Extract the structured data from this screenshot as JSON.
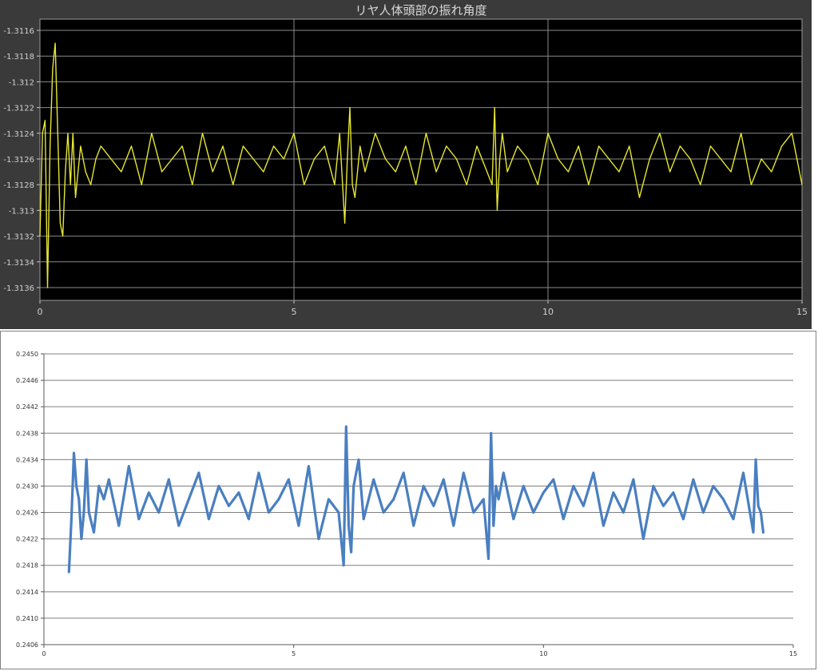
{
  "chart_data": [
    {
      "type": "line",
      "title": "リヤ人体頭部の振れ角度",
      "xlabel": "",
      "ylabel": "",
      "xlim": [
        0,
        15
      ],
      "ylim": [
        -1.3137,
        -1.3115
      ],
      "xticks": [
        0,
        5,
        10,
        15
      ],
      "xtick_labels": [
        "0",
        "5",
        "10",
        "15"
      ],
      "yticks": [
        -1.3116,
        -1.3118,
        -1.312,
        -1.3122,
        -1.3124,
        -1.3126,
        -1.3128,
        -1.313,
        -1.3132,
        -1.3134,
        -1.3136
      ],
      "ytick_labels": [
        "-1.3116",
        "-1.3118",
        "-1.312",
        "-1.3122",
        "-1.3124",
        "-1.3126",
        "-1.3128",
        "-1.313",
        "-1.3132",
        "-1.3134",
        "-1.3136"
      ],
      "grid": true,
      "colors": {
        "background": "#000000",
        "line": "#e6e632",
        "grid": "#8a8a8a",
        "panel": "#3a3a3a"
      },
      "series": [
        {
          "x": [
            0,
            0.05,
            0.1,
            0.15,
            0.2,
            0.25,
            0.3,
            0.35,
            0.4,
            0.45,
            0.5,
            0.55,
            0.6,
            0.65,
            0.7,
            0.8,
            0.9,
            1.0,
            1.1,
            1.2,
            1.4,
            1.6,
            1.8,
            2.0,
            2.2,
            2.4,
            2.6,
            2.8,
            3.0,
            3.2,
            3.4,
            3.6,
            3.8,
            4.0,
            4.2,
            4.4,
            4.6,
            4.8,
            5.0,
            5.2,
            5.4,
            5.6,
            5.8,
            5.9,
            6.0,
            6.05,
            6.1,
            6.15,
            6.2,
            6.3,
            6.4,
            6.6,
            6.8,
            7.0,
            7.2,
            7.4,
            7.6,
            7.8,
            8.0,
            8.2,
            8.4,
            8.6,
            8.8,
            8.9,
            8.95,
            9.0,
            9.05,
            9.1,
            9.2,
            9.4,
            9.6,
            9.8,
            10.0,
            10.2,
            10.4,
            10.6,
            10.8,
            11.0,
            11.2,
            11.4,
            11.6,
            11.8,
            12.0,
            12.2,
            12.4,
            12.6,
            12.8,
            13.0,
            13.2,
            13.4,
            13.6,
            13.8,
            14.0,
            14.2,
            14.4,
            14.6,
            14.8,
            15.0
          ],
          "y": [
            -1.3132,
            -1.3124,
            -1.3123,
            -1.3136,
            -1.3125,
            -1.3119,
            -1.3117,
            -1.3124,
            -1.3131,
            -1.3132,
            -1.3127,
            -1.3124,
            -1.3128,
            -1.3124,
            -1.3129,
            -1.3125,
            -1.3127,
            -1.3128,
            -1.3126,
            -1.3125,
            -1.3126,
            -1.3127,
            -1.3125,
            -1.3128,
            -1.3124,
            -1.3127,
            -1.3126,
            -1.3125,
            -1.3128,
            -1.3124,
            -1.3127,
            -1.3125,
            -1.3128,
            -1.3125,
            -1.3126,
            -1.3127,
            -1.3125,
            -1.3126,
            -1.3124,
            -1.3128,
            -1.3126,
            -1.3125,
            -1.3128,
            -1.3124,
            -1.3131,
            -1.3126,
            -1.3122,
            -1.3128,
            -1.3129,
            -1.3125,
            -1.3127,
            -1.3124,
            -1.3126,
            -1.3127,
            -1.3125,
            -1.3128,
            -1.3124,
            -1.3127,
            -1.3125,
            -1.3126,
            -1.3128,
            -1.3125,
            -1.3127,
            -1.3128,
            -1.3122,
            -1.313,
            -1.3126,
            -1.3124,
            -1.3127,
            -1.3125,
            -1.3126,
            -1.3128,
            -1.3124,
            -1.3126,
            -1.3127,
            -1.3125,
            -1.3128,
            -1.3125,
            -1.3126,
            -1.3127,
            -1.3125,
            -1.3129,
            -1.3126,
            -1.3124,
            -1.3127,
            -1.3125,
            -1.3126,
            -1.3128,
            -1.3125,
            -1.3126,
            -1.3127,
            -1.3124,
            -1.3128,
            -1.3126,
            -1.3127,
            -1.3125,
            -1.3124,
            -1.3128
          ]
        }
      ]
    },
    {
      "type": "line",
      "title": "",
      "xlabel": "",
      "ylabel": "",
      "xlim": [
        0,
        15
      ],
      "ylim": [
        0.2406,
        0.245
      ],
      "xticks": [
        0,
        5,
        10,
        15
      ],
      "xtick_labels": [
        "0",
        "5",
        "10",
        "15"
      ],
      "yticks": [
        0.245,
        0.2446,
        0.2442,
        0.2438,
        0.2434,
        0.243,
        0.2426,
        0.2422,
        0.2418,
        0.2414,
        0.241,
        0.2406
      ],
      "ytick_labels": [
        "0.2450",
        "0.2446",
        "0.2442",
        "0.2438",
        "0.2434",
        "0.2430",
        "0.2426",
        "0.2422",
        "0.2418",
        "0.2414",
        "0.2410",
        "0.2406"
      ],
      "grid": true,
      "colors": {
        "background": "#ffffff",
        "line": "#4a7fc1",
        "grid": "#7f7f7f",
        "axis": "#595959"
      },
      "series": [
        {
          "x": [
            0.5,
            0.55,
            0.6,
            0.65,
            0.7,
            0.75,
            0.8,
            0.85,
            0.9,
            1.0,
            1.1,
            1.2,
            1.3,
            1.5,
            1.7,
            1.9,
            2.1,
            2.3,
            2.5,
            2.7,
            2.9,
            3.1,
            3.3,
            3.5,
            3.7,
            3.9,
            4.1,
            4.3,
            4.5,
            4.7,
            4.9,
            5.1,
            5.3,
            5.5,
            5.7,
            5.9,
            6.0,
            6.05,
            6.1,
            6.15,
            6.2,
            6.3,
            6.4,
            6.6,
            6.8,
            7.0,
            7.2,
            7.4,
            7.6,
            7.8,
            8.0,
            8.2,
            8.4,
            8.6,
            8.8,
            8.9,
            8.95,
            9.0,
            9.05,
            9.1,
            9.2,
            9.4,
            9.6,
            9.8,
            10.0,
            10.2,
            10.4,
            10.6,
            10.8,
            11.0,
            11.2,
            11.4,
            11.6,
            11.8,
            12.0,
            12.2,
            12.4,
            12.6,
            12.8,
            13.0,
            13.2,
            13.4,
            13.6,
            13.8,
            14.0,
            14.2,
            14.25,
            14.3,
            14.35,
            14.4
          ],
          "y": [
            0.2417,
            0.2425,
            0.2435,
            0.243,
            0.2428,
            0.2422,
            0.2426,
            0.2434,
            0.2426,
            0.2423,
            0.243,
            0.2428,
            0.2431,
            0.2424,
            0.2433,
            0.2425,
            0.2429,
            0.2426,
            0.2431,
            0.2424,
            0.2428,
            0.2432,
            0.2425,
            0.243,
            0.2427,
            0.2429,
            0.2425,
            0.2432,
            0.2426,
            0.2428,
            0.2431,
            0.2424,
            0.2433,
            0.2422,
            0.2428,
            0.2426,
            0.2418,
            0.2439,
            0.2424,
            0.242,
            0.243,
            0.2434,
            0.2425,
            0.2431,
            0.2426,
            0.2428,
            0.2432,
            0.2424,
            0.243,
            0.2427,
            0.2431,
            0.2424,
            0.2432,
            0.2426,
            0.2428,
            0.2419,
            0.2438,
            0.2424,
            0.243,
            0.2428,
            0.2432,
            0.2425,
            0.243,
            0.2426,
            0.2429,
            0.2431,
            0.2425,
            0.243,
            0.2427,
            0.2432,
            0.2424,
            0.2429,
            0.2426,
            0.2431,
            0.2422,
            0.243,
            0.2427,
            0.2429,
            0.2425,
            0.2431,
            0.2426,
            0.243,
            0.2428,
            0.2425,
            0.2432,
            0.2423,
            0.2434,
            0.2427,
            0.2426,
            0.2423
          ]
        }
      ]
    }
  ]
}
